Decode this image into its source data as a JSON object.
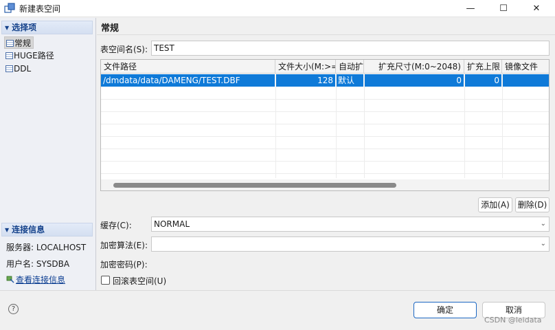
{
  "window": {
    "title": "新建表空间",
    "minimize_glyph": "—",
    "maximize_glyph": "☐",
    "close_glyph": "✕"
  },
  "sidebar": {
    "options_header": "选择项",
    "items": [
      {
        "label": "常规",
        "selected": true
      },
      {
        "label": "HUGE路径",
        "selected": false
      },
      {
        "label": "DDL",
        "selected": false
      }
    ],
    "connection_header": "连接信息",
    "server": "服务器: LOCALHOST",
    "user": "用户名: SYSDBA",
    "view_link": "查看连接信息"
  },
  "main": {
    "title": "常规",
    "tablespace_label": "表空间名(S):",
    "tablespace_value": "TEST",
    "table": {
      "columns": [
        "文件路径",
        "文件大小(M:>=",
        "自动扩",
        "扩充尺寸(M:0~2048)",
        "扩充上限",
        "镜像文件"
      ],
      "rows": [
        {
          "path": "/dmdata/data/DAMENG/TEST.DBF",
          "size": "128",
          "auto": "默认",
          "extend": "0",
          "max": "0",
          "mirror": ""
        }
      ]
    },
    "add_button": "添加(A)",
    "delete_button": "删除(D)",
    "cache_label": "缓存(C):",
    "cache_value": "NORMAL",
    "encrypt_algo_label": "加密算法(E):",
    "encrypt_algo_value": "",
    "encrypt_pwd_label": "加密密码(P):",
    "rollback_label": "回滚表空间(U)",
    "rollback_checked": false
  },
  "footer": {
    "help_glyph": "?",
    "ok_button": "确定",
    "cancel_button": "取消",
    "watermark": "CSDN @leidata"
  },
  "colors": {
    "selection": "#0f7ad8",
    "section_header_text": "#15428b",
    "ok_border": "#1a66c2"
  }
}
